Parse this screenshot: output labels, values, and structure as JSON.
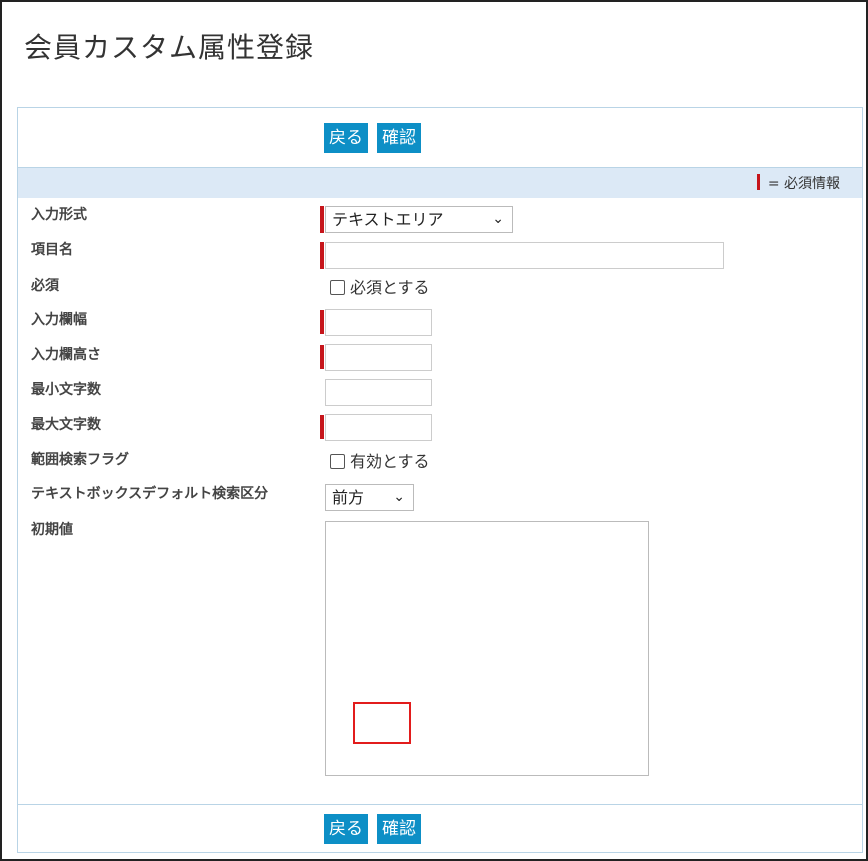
{
  "page": {
    "title": "会員カスタム属性登録"
  },
  "buttons": {
    "back": "戻る",
    "confirm": "確認"
  },
  "legend": {
    "required_text": "= 必須情報"
  },
  "form": {
    "input_format": {
      "label": "入力形式",
      "value": "テキストエリア",
      "required": true
    },
    "item_name": {
      "label": "項目名",
      "value": "",
      "required": true
    },
    "required_flag": {
      "label": "必須",
      "checkbox_label": "必須とする",
      "checked": false
    },
    "field_width": {
      "label": "入力欄幅",
      "value": "",
      "required": true
    },
    "field_height": {
      "label": "入力欄高さ",
      "value": "",
      "required": true
    },
    "min_chars": {
      "label": "最小文字数",
      "value": "",
      "required": false
    },
    "max_chars": {
      "label": "最大文字数",
      "value": "",
      "required": true
    },
    "range_search": {
      "label": "範囲検索フラグ",
      "checkbox_label": "有効とする",
      "checked": false
    },
    "textbox_search_mode": {
      "label": "テキストボックスデフォルト検索区分",
      "value": "前方"
    },
    "initial_value": {
      "label": "初期値",
      "value": ""
    }
  },
  "colors": {
    "button_bg": "#0d8fc6",
    "required_marker": "#c6151b",
    "band_bg": "#dce9f6",
    "highlight": "#e21c1c"
  }
}
